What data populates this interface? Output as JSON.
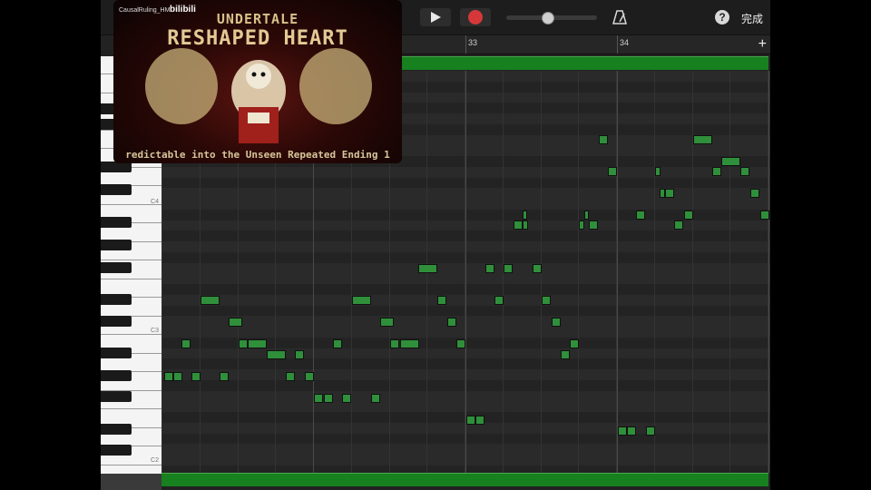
{
  "toolbar": {
    "help_label": "?",
    "done_label": "完成",
    "volume_slider": 0.45
  },
  "ruler": {
    "bars": [
      {
        "label": "33"
      },
      {
        "label": "34"
      }
    ],
    "add_label": "+"
  },
  "keyboard": {
    "labels": [
      "C4",
      "C3",
      "C2"
    ]
  },
  "video_overlay": {
    "uploader": "CausalRuling_HM",
    "logo": "bilibili",
    "title_line1": "UNDERTALE",
    "title_line2": "RESHAPED HEART",
    "caption": "redictable into the Unseen Repeated Ending 1"
  },
  "colors": {
    "note_green": "#2f8f3a",
    "region_green": "#17801f",
    "record_red": "#d6383a"
  }
}
